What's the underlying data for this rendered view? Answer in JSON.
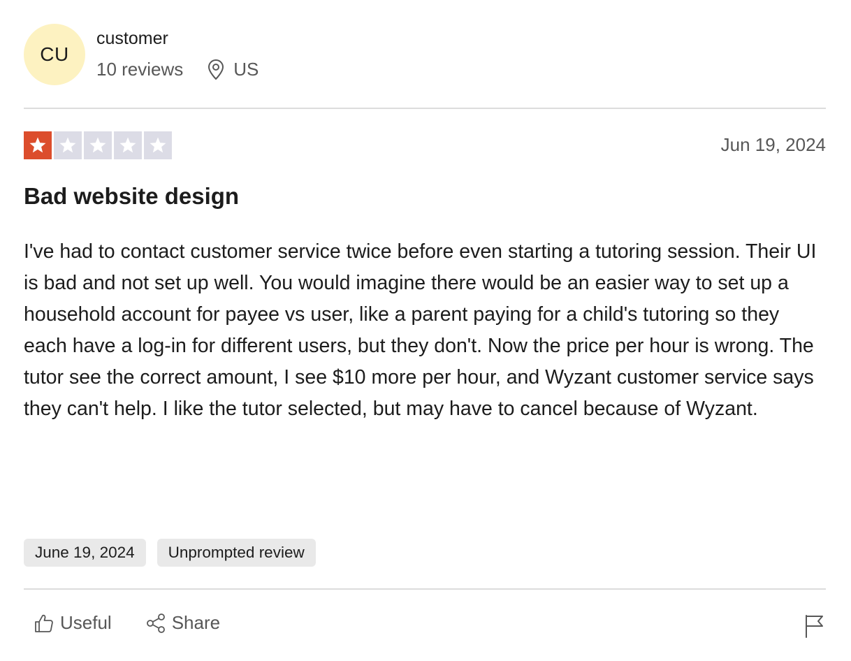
{
  "reviewer": {
    "initials": "CU",
    "name": "customer",
    "reviews_count": "10 reviews",
    "location": "US",
    "location_icon": "location-pin-icon"
  },
  "review": {
    "rating": 1,
    "rating_max": 5,
    "star_color": "#dc4d2c",
    "star_empty_color": "#dcdce6",
    "date": "Jun 19, 2024",
    "title": "Bad website design",
    "body": "I've had to contact customer service twice before even starting a tutoring session. Their UI is bad and not set up well. You would imagine there would be an easier way to set up a household account for payee vs user, like a parent paying for a child's tutoring so they each have a log-in for different users, but they don't. Now the price per hour is wrong. The tutor see the correct amount, I see $10 more per hour, and Wyzant customer service says they can't help. I like the tutor selected, but may have to cancel because of Wyzant."
  },
  "chips": {
    "date": "June 19, 2024",
    "type": "Unprompted review"
  },
  "actions": {
    "useful_label": "Useful",
    "useful_icon": "thumbs-up-icon",
    "share_label": "Share",
    "share_icon": "share-icon",
    "report_icon": "flag-icon"
  }
}
